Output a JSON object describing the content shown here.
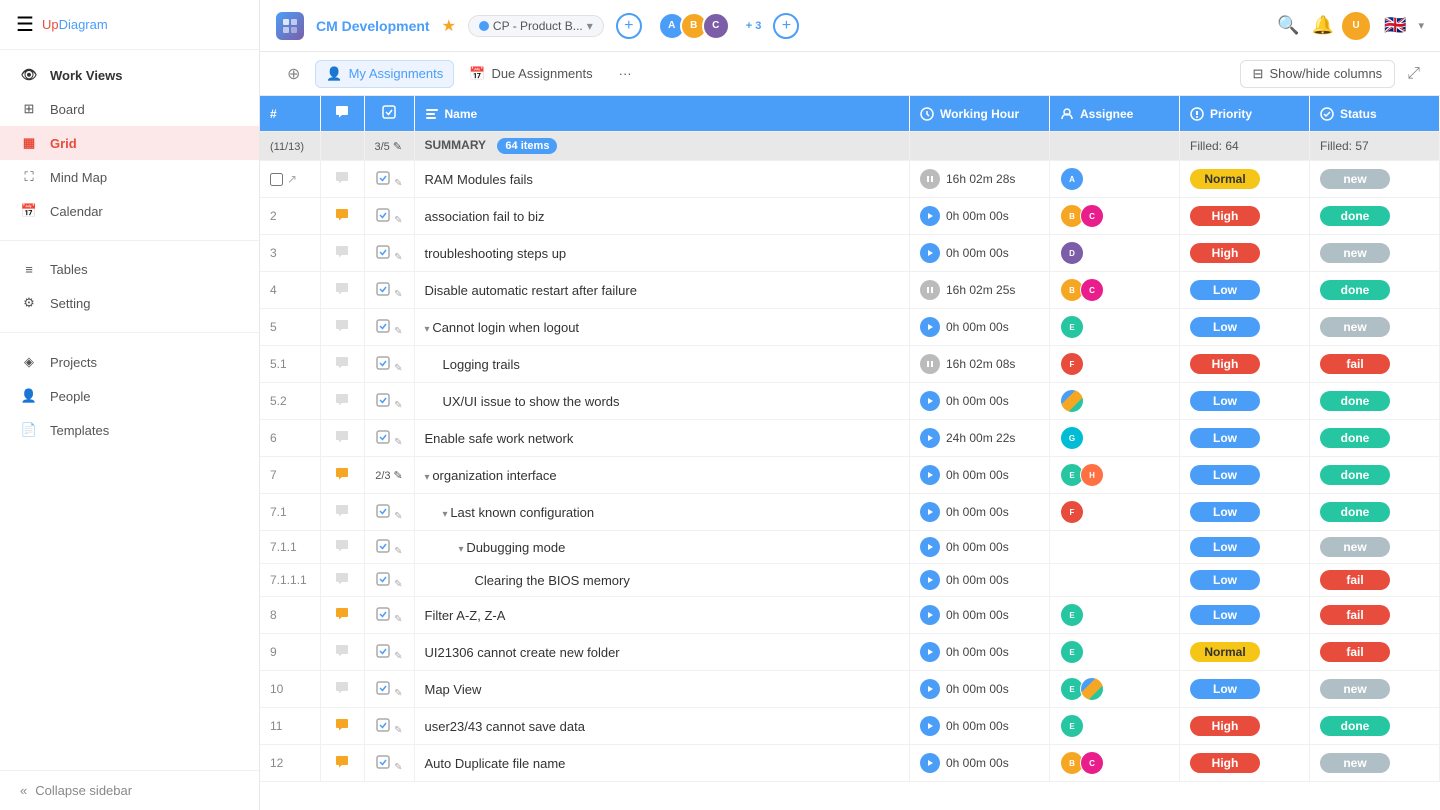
{
  "app": {
    "logo_up": "Up",
    "logo_diagram": "Diagram"
  },
  "sidebar": {
    "collapse_label": "Collapse sidebar",
    "work_views_label": "Work Views",
    "items": [
      {
        "id": "board",
        "label": "Board",
        "icon": "⊞",
        "active": false
      },
      {
        "id": "grid",
        "label": "Grid",
        "icon": "▦",
        "active": true
      },
      {
        "id": "mind-map",
        "label": "Mind Map",
        "icon": "⛶",
        "active": false
      },
      {
        "id": "calendar",
        "label": "Calendar",
        "icon": "▦",
        "active": false
      }
    ],
    "section_items": [
      {
        "id": "tables",
        "label": "Tables",
        "icon": "≡"
      },
      {
        "id": "setting",
        "label": "Setting",
        "icon": "⚙"
      },
      {
        "id": "projects",
        "label": "Projects",
        "icon": "◈"
      },
      {
        "id": "people",
        "label": "People",
        "icon": "👤"
      },
      {
        "id": "templates",
        "label": "Templates",
        "icon": "📄"
      }
    ]
  },
  "topnav": {
    "project_name": "CM Development",
    "status_label": "CP - Product B...",
    "avatar_count": "+ 3",
    "flag": "🇬🇧"
  },
  "toolbar": {
    "add_label": "+",
    "my_assignments_label": "My Assignments",
    "due_assignments_label": "Due Assignments",
    "more_label": "···",
    "show_hide_label": "Show/hide columns"
  },
  "table": {
    "headers": [
      {
        "id": "num",
        "label": "#"
      },
      {
        "id": "chat",
        "label": "💬"
      },
      {
        "id": "check",
        "label": "✓"
      },
      {
        "id": "name",
        "label": "Name"
      },
      {
        "id": "working_hour",
        "label": "Working Hour"
      },
      {
        "id": "assignee",
        "label": "Assignee"
      },
      {
        "id": "priority",
        "label": "Priority"
      },
      {
        "id": "status",
        "label": "Status"
      }
    ],
    "summary": {
      "count_label": "(11/13)",
      "sub_count": "3/5",
      "summary_text": "SUMMARY",
      "items_count": "64 items",
      "filled_priority": "Filled: 64",
      "filled_status": "Filled: 57"
    },
    "rows": [
      {
        "num": "",
        "chat": false,
        "name": "RAM Modules fails",
        "indent": 0,
        "time": "16h 02m 28s",
        "paused": true,
        "assignees": [
          "img1"
        ],
        "priority": "normal",
        "priority_label": "Normal",
        "status": "new",
        "status_label": "new"
      },
      {
        "num": "2",
        "chat": true,
        "name": "association fail to biz",
        "indent": 0,
        "time": "0h 00m 00s",
        "paused": false,
        "assignees": [
          "img2",
          "img3"
        ],
        "priority": "high",
        "priority_label": "High",
        "status": "done",
        "status_label": "done"
      },
      {
        "num": "3",
        "chat": false,
        "name": "troubleshooting steps up",
        "indent": 0,
        "time": "0h 00m 00s",
        "paused": false,
        "assignees": [
          "img4"
        ],
        "priority": "high",
        "priority_label": "High",
        "status": "new",
        "status_label": "new"
      },
      {
        "num": "4",
        "chat": false,
        "name": "Disable automatic restart after failure",
        "indent": 0,
        "time": "16h 02m 25s",
        "paused": true,
        "assignees": [
          "img2",
          "img3"
        ],
        "priority": "low",
        "priority_label": "Low",
        "status": "done",
        "status_label": "done"
      },
      {
        "num": "5",
        "chat": false,
        "name": "Cannot login when logout",
        "indent": 0,
        "time": "0h 00m 00s",
        "paused": false,
        "assignees": [
          "img5"
        ],
        "has_collapse": true,
        "priority": "low",
        "priority_label": "Low",
        "status": "new",
        "status_label": "new"
      },
      {
        "num": "5.1",
        "chat": false,
        "name": "Logging trails",
        "indent": 1,
        "time": "16h 02m 08s",
        "paused": true,
        "assignees": [
          "img6"
        ],
        "priority": "high",
        "priority_label": "High",
        "status": "fail",
        "status_label": "fail"
      },
      {
        "num": "5.2",
        "chat": false,
        "name": "UX/UI issue to show the words",
        "indent": 1,
        "time": "0h 00m 00s",
        "paused": false,
        "assignees": [
          "stripe"
        ],
        "priority": "low",
        "priority_label": "Low",
        "status": "done",
        "status_label": "done"
      },
      {
        "num": "6",
        "chat": false,
        "name": "Enable safe work network",
        "indent": 0,
        "time": "24h 00m 22s",
        "paused": false,
        "assignees": [
          "img7"
        ],
        "priority": "low",
        "priority_label": "Low",
        "status": "done",
        "status_label": "done"
      },
      {
        "num": "7",
        "chat": true,
        "name": "organization interface",
        "indent": 0,
        "time": "0h 00m 00s",
        "paused": false,
        "assignees": [
          "img5",
          "img8"
        ],
        "has_collapse": true,
        "sub_count": "2/3",
        "priority": "low",
        "priority_label": "Low",
        "status": "done",
        "status_label": "done"
      },
      {
        "num": "7.1",
        "chat": false,
        "name": "Last known configuration",
        "indent": 1,
        "time": "0h 00m 00s",
        "paused": false,
        "assignees": [
          "img6"
        ],
        "has_collapse": true,
        "priority": "low",
        "priority_label": "Low",
        "status": "done",
        "status_label": "done"
      },
      {
        "num": "7.1.1",
        "chat": false,
        "name": "Dubugging mode",
        "indent": 2,
        "time": "0h 00m 00s",
        "paused": false,
        "assignees": [],
        "has_collapse": true,
        "priority": "low",
        "priority_label": "Low",
        "status": "new",
        "status_label": "new"
      },
      {
        "num": "7.1.1.1",
        "chat": false,
        "name": "Clearing the BIOS memory",
        "indent": 3,
        "time": "0h 00m 00s",
        "paused": false,
        "assignees": [],
        "priority": "low",
        "priority_label": "Low",
        "status": "fail",
        "status_label": "fail"
      },
      {
        "num": "8",
        "chat": true,
        "name": "Filter A-Z, Z-A",
        "indent": 0,
        "time": "0h 00m 00s",
        "paused": false,
        "assignees": [
          "img5"
        ],
        "priority": "low",
        "priority_label": "Low",
        "status": "fail",
        "status_label": "fail"
      },
      {
        "num": "9",
        "chat": false,
        "name": "UI21306 cannot create new folder",
        "indent": 0,
        "time": "0h 00m 00s",
        "paused": false,
        "assignees": [
          "img5"
        ],
        "priority": "normal",
        "priority_label": "Normal",
        "status": "fail",
        "status_label": "fail"
      },
      {
        "num": "10",
        "chat": false,
        "name": "Map View",
        "indent": 0,
        "time": "0h 00m 00s",
        "paused": false,
        "assignees": [
          "img5",
          "stripe2"
        ],
        "priority": "low",
        "priority_label": "Low",
        "status": "new",
        "status_label": "new"
      },
      {
        "num": "11",
        "chat": true,
        "name": "user23/43 cannot save data",
        "indent": 0,
        "time": "0h 00m 00s",
        "paused": false,
        "assignees": [
          "img5"
        ],
        "priority": "high",
        "priority_label": "High",
        "status": "done",
        "status_label": "done"
      },
      {
        "num": "12",
        "chat": true,
        "name": "Auto Duplicate file name",
        "indent": 0,
        "time": "0h 00m 00s",
        "paused": false,
        "assignees": [
          "img2",
          "img3"
        ],
        "priority": "high",
        "priority_label": "High",
        "status": "new",
        "status_label": "new"
      }
    ]
  }
}
